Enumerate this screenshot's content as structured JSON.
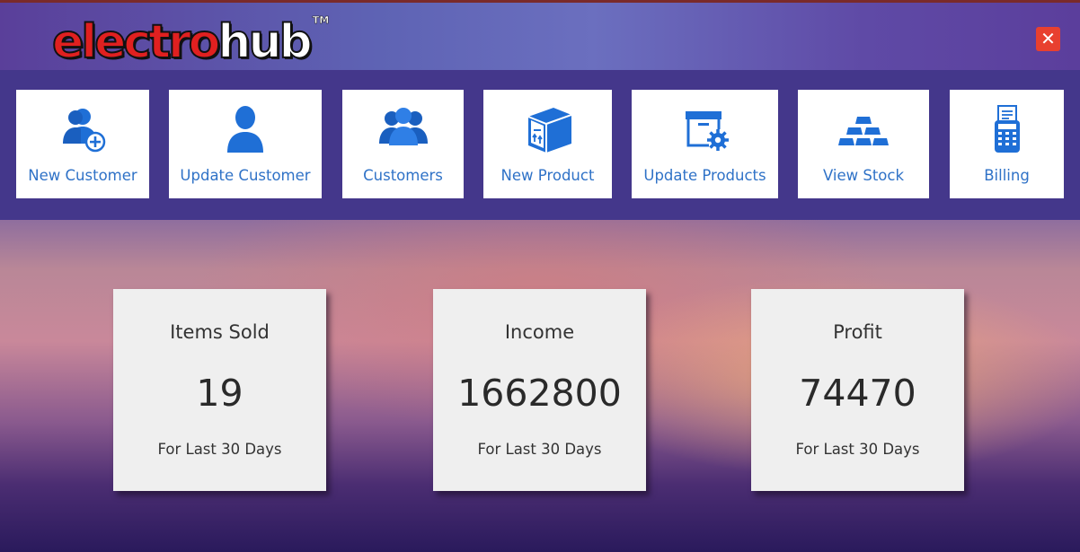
{
  "header": {
    "logo": {
      "part1": "electro",
      "part2": "hub",
      "tm": "TM"
    },
    "close_label": "✕"
  },
  "nav": {
    "items": [
      {
        "label": "New Customer",
        "icon": "new-customer-icon"
      },
      {
        "label": "Update Customer",
        "icon": "update-customer-icon"
      },
      {
        "label": "Customers",
        "icon": "customers-icon"
      },
      {
        "label": "New Product",
        "icon": "new-product-icon"
      },
      {
        "label": "Update Products",
        "icon": "update-products-icon"
      },
      {
        "label": "View Stock",
        "icon": "view-stock-icon"
      },
      {
        "label": "Billing",
        "icon": "billing-icon"
      }
    ],
    "accent_color": "#2f72c7"
  },
  "stats": {
    "items_sold": {
      "title": "Items Sold",
      "value": "19",
      "period": "For Last 30 Days"
    },
    "income": {
      "title": "Income",
      "value": "1662800",
      "period": "For Last 30 Days"
    },
    "profit": {
      "title": "Profit",
      "value": "74470",
      "period": "For Last 30 Days"
    }
  },
  "colors": {
    "navbar_bg": "#44378b",
    "close_button": "#e8402f",
    "logo_red": "#e02020"
  }
}
